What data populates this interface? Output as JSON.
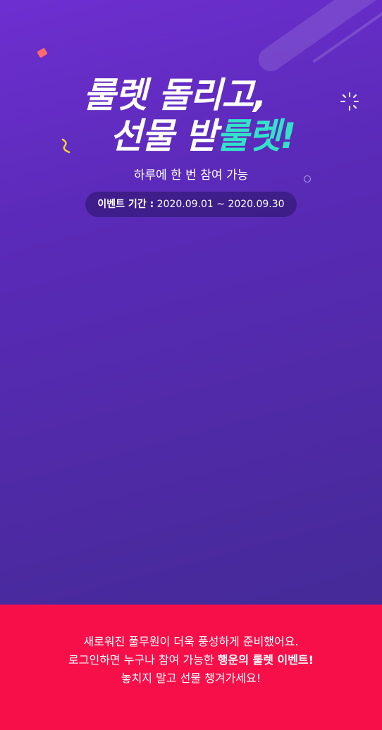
{
  "hero": {
    "title_line1": "룰렛 돌리고,",
    "title_line2_prefix": "선물 받",
    "title_line2_accent": "룰렛!",
    "subtitle": "하루에 한 번 참여 가능",
    "period_label": "이벤트 기간 :",
    "period_value": "2020.09.01 ~ 2020.09.30",
    "colors": {
      "accent": "#33e3c8",
      "background": "#5a2ab8"
    }
  },
  "footer": {
    "line1": "새로워진 풀무원이 더욱 풍성하게 준비했어요.",
    "line2_prefix": "로그인하면 누구나 참여 가능한 ",
    "line2_bold": "행운의 룰렛 이벤트!",
    "line3": "놓치지 말고 선물 챙겨가세요!",
    "colors": {
      "background": "#f70f4a"
    }
  }
}
